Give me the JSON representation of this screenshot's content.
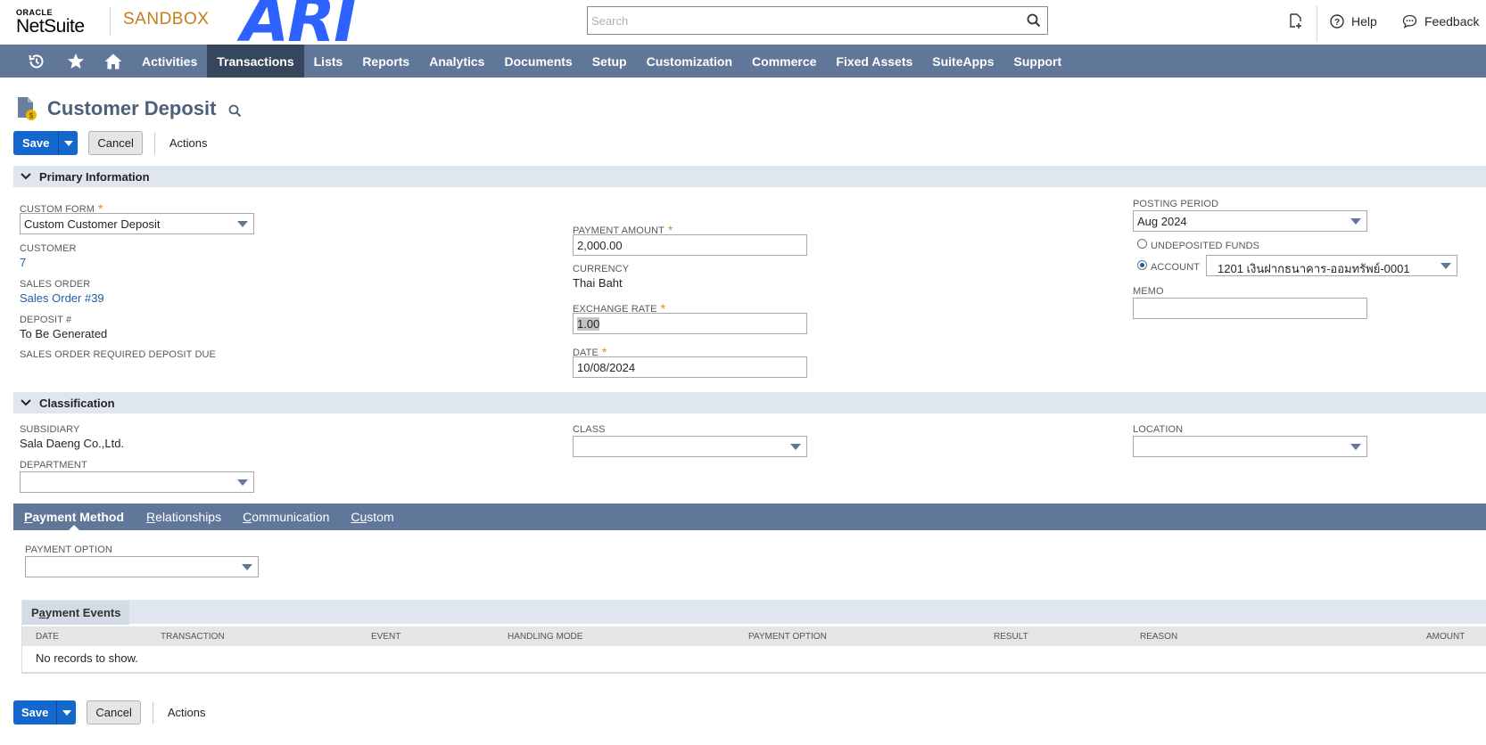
{
  "header": {
    "oracle_label": "ORACLE",
    "netsuite_label": "NetSuite",
    "environment": "SANDBOX",
    "brand": "ARI",
    "search_placeholder": "Search",
    "help_label": "Help",
    "feedback_label": "Feedback"
  },
  "nav": {
    "items": [
      "Activities",
      "Transactions",
      "Lists",
      "Reports",
      "Analytics",
      "Documents",
      "Setup",
      "Customization",
      "Commerce",
      "Fixed Assets",
      "SuiteApps",
      "Support"
    ],
    "active": "Transactions"
  },
  "page": {
    "title": "Customer Deposit"
  },
  "buttons": {
    "save": "Save",
    "cancel": "Cancel",
    "actions": "Actions"
  },
  "primary": {
    "section_title": "Primary Information",
    "custom_form_label": "CUSTOM FORM",
    "custom_form_value": "Custom Customer Deposit",
    "customer_label": "CUSTOMER",
    "customer_value": "7",
    "sales_order_label": "SALES ORDER",
    "sales_order_value": "Sales Order #39",
    "deposit_label": "DEPOSIT #",
    "deposit_value": "To Be Generated",
    "so_required_label": "SALES ORDER REQUIRED DEPOSIT DUE",
    "payment_amount_label": "PAYMENT AMOUNT",
    "payment_amount_value": "2,000.00",
    "currency_label": "CURRENCY",
    "currency_value": "Thai Baht",
    "exchange_rate_label": "EXCHANGE RATE",
    "exchange_rate_value": "1.00",
    "date_label": "DATE",
    "date_value": "10/08/2024",
    "posting_period_label": "POSTING PERIOD",
    "posting_period_value": "Aug 2024",
    "undeposited_label": "UNDEPOSITED FUNDS",
    "account_label": "ACCOUNT",
    "account_value": "1201 เงินฝากธนาคาร-ออมทรัพย์-0001",
    "memo_label": "MEMO",
    "memo_value": ""
  },
  "classification": {
    "section_title": "Classification",
    "subsidiary_label": "SUBSIDIARY",
    "subsidiary_value": "Sala Daeng Co.,Ltd.",
    "department_label": "DEPARTMENT",
    "class_label": "CLASS",
    "location_label": "LOCATION"
  },
  "subtabs": [
    {
      "first": "P",
      "rest": "ayment Method",
      "active": true
    },
    {
      "first": "R",
      "rest": "elationships",
      "active": false
    },
    {
      "first": "C",
      "rest": "ommunication",
      "active": false
    },
    {
      "first": "Cu",
      "rest": "stom",
      "active": false
    }
  ],
  "payment_method": {
    "payment_option_label": "PAYMENT OPTION",
    "payment_option_value": ""
  },
  "payment_events": {
    "title_pre": "P",
    "title_u": "a",
    "title_post": "yment Events",
    "columns": [
      "DATE",
      "TRANSACTION",
      "EVENT",
      "HANDLING MODE",
      "PAYMENT OPTION",
      "RESULT",
      "REASON",
      "AMOUNT"
    ],
    "empty_text": "No records to show."
  },
  "colors": {
    "nav_bg": "#607799",
    "nav_active": "#36465c",
    "save_blue": "#1467cc",
    "sandbox_orange": "#c67c18",
    "required_orange": "#e48917",
    "link_blue": "#255ba8"
  }
}
